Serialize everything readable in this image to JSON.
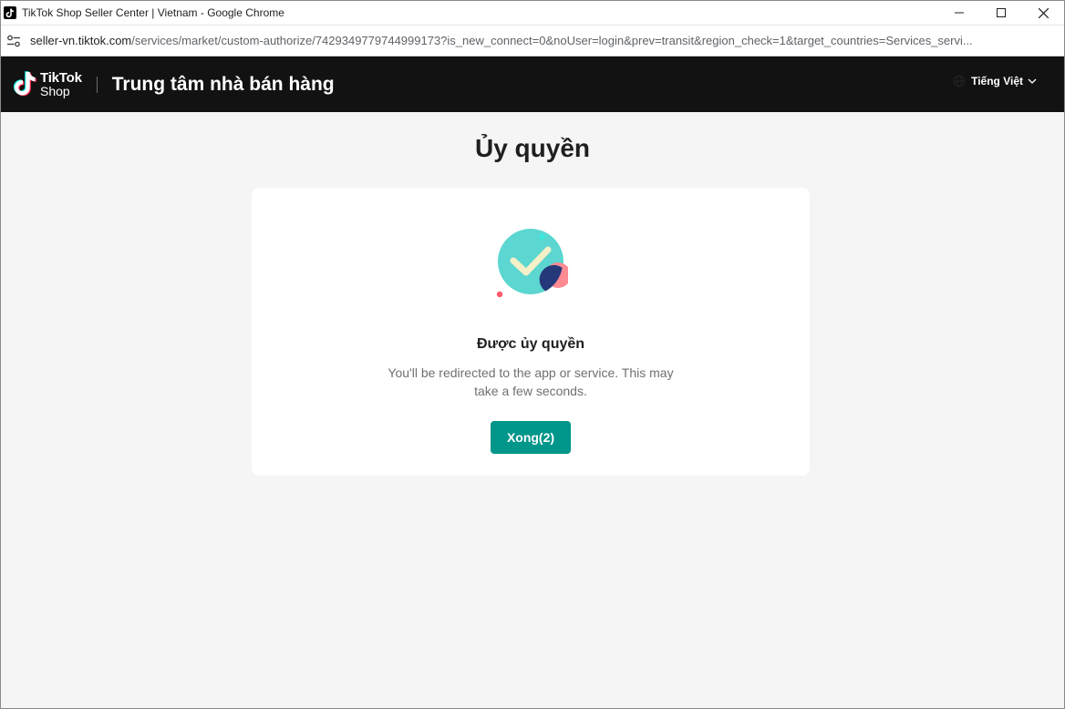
{
  "window": {
    "title": "TikTok Shop Seller Center | Vietnam - Google Chrome"
  },
  "address_bar": {
    "host": "seller-vn.tiktok.com",
    "path": "/services/market/custom-authorize/7429349779744999173?is_new_connect=0&noUser=login&prev=transit&region_check=1&target_countries=Services_servi..."
  },
  "header": {
    "logo_line1": "TikTok",
    "logo_line2": "Shop",
    "title": "Trung tâm nhà bán hàng",
    "language": "Tiếng Việt"
  },
  "main": {
    "page_title": "Ủy quyền",
    "card": {
      "heading": "Được ủy quyền",
      "description": "You'll be redirected to the app or service. This may take a few seconds.",
      "button_label": "Xong(2)"
    }
  },
  "colors": {
    "header_bg": "#121212",
    "accent": "#00968a",
    "page_bg": "#f5f5f5",
    "illustration_teal": "#5cd6d0",
    "illustration_navy": "#25397a",
    "illustration_pink": "#fe8a92"
  },
  "icons": {
    "favicon": "tiktok-icon",
    "site_info": "tune-icon",
    "language": "globe-icon",
    "dropdown": "chevron-down-icon",
    "success": "check-circle-illustration"
  }
}
